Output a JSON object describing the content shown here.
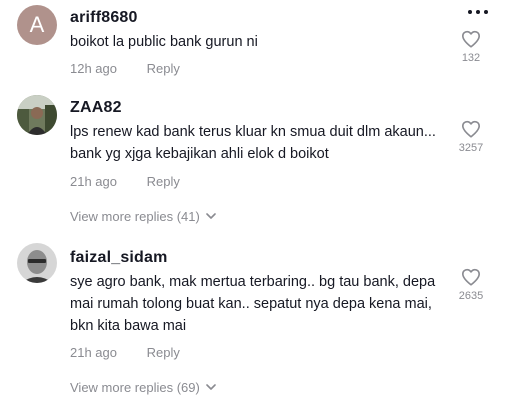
{
  "comments": [
    {
      "avatar_letter": "A",
      "username": "ariff8680",
      "text": "boikot la public bank gurun ni",
      "time": "12h ago",
      "reply_label": "Reply",
      "likes": "132"
    },
    {
      "username": "ZAA82",
      "text": "lps renew kad bank terus kluar kn smua duit dlm akaun... bank yg xjga kebajikan ahli elok d boikot",
      "time": "21h ago",
      "reply_label": "Reply",
      "likes": "3257",
      "view_more": "View more replies (41)"
    },
    {
      "username": "faizal_sidam",
      "text": "sye agro bank, mak mertua terbaring.. bg tau bank, depa mai rumah tolong buat kan.. sepatut nya depa kena mai, bkn kita bawa mai",
      "time": "21h ago",
      "reply_label": "Reply",
      "likes": "2635",
      "view_more": "View more replies (69)"
    }
  ],
  "icons": {
    "more": "more-options-icon",
    "like": "heart-outline-icon",
    "chevron": "chevron-down-icon"
  }
}
